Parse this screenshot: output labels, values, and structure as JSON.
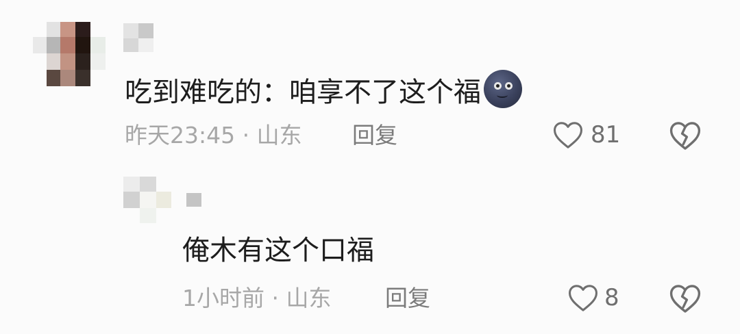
{
  "comments": [
    {
      "text": "吃到难吃的：咱享不了这个福",
      "emoji": "new-moon-face-emoji",
      "time_location": "昨天23:45 · 山东",
      "reply_label": "回复",
      "like_count": "81"
    },
    {
      "text": "俺木有这个口福",
      "time_location": "1小时前 · 山东",
      "reply_label": "回复",
      "like_count": "8"
    }
  ],
  "colors": {
    "text": "#1d1d1d",
    "meta": "#a7a7a7",
    "icon": "#6f6f6f",
    "background": "#fbfbfb"
  }
}
